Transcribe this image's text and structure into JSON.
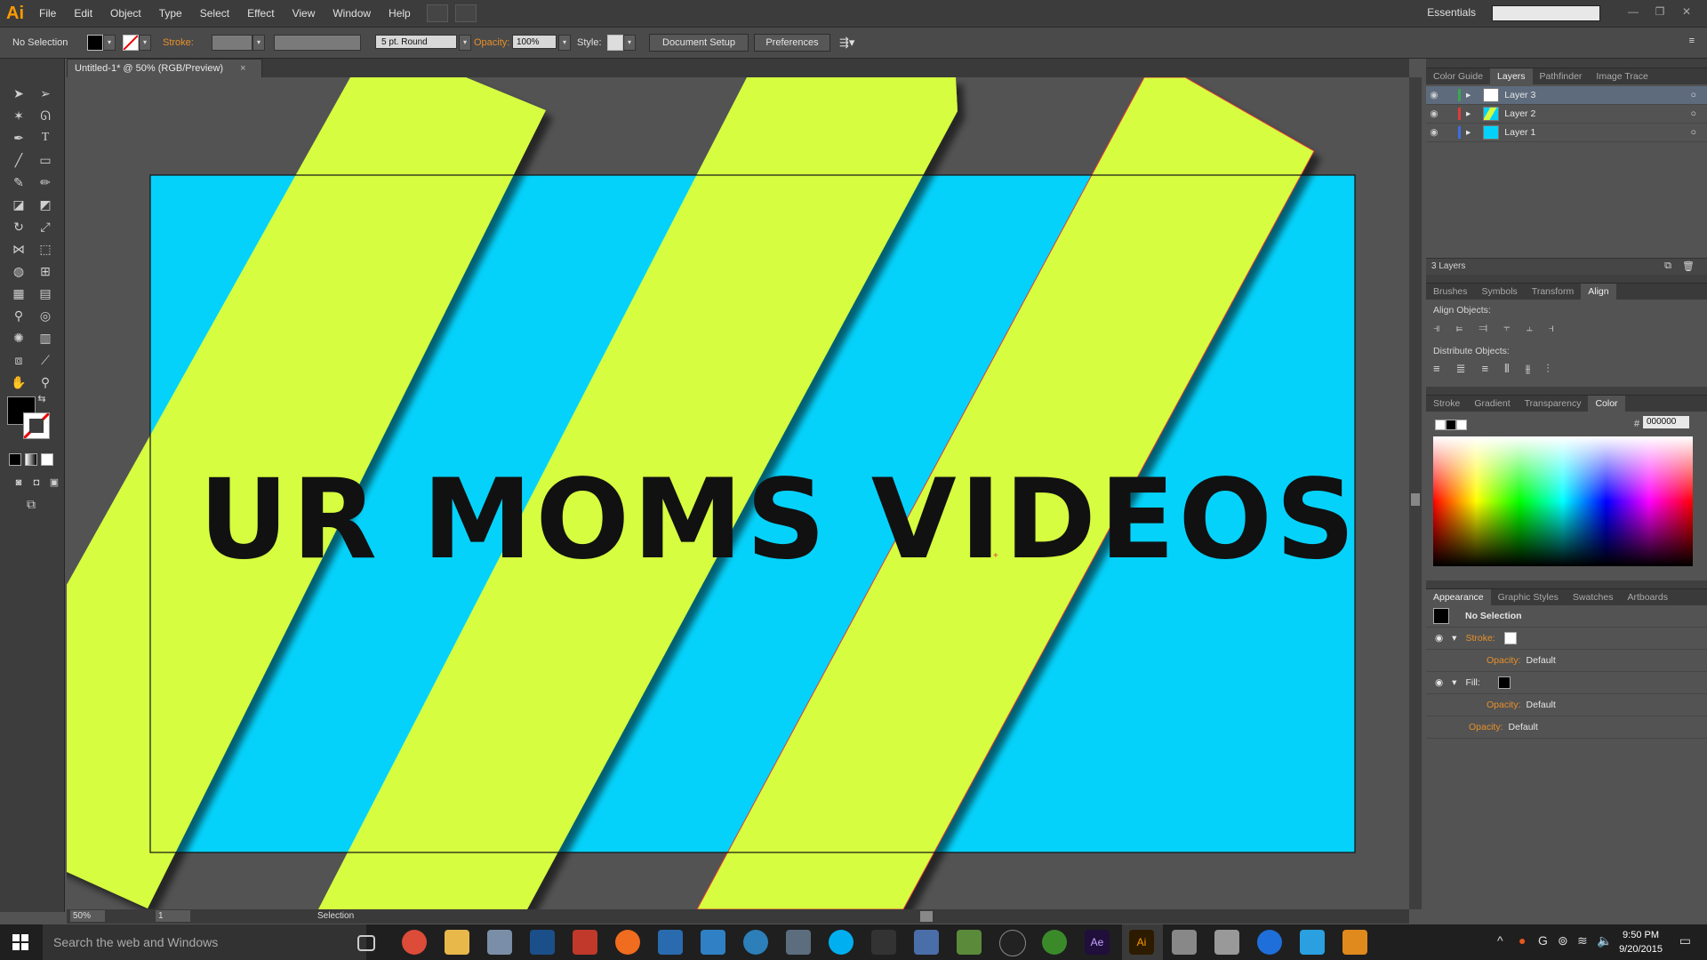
{
  "app": {
    "logo": "Ai"
  },
  "menu": [
    "File",
    "Edit",
    "Object",
    "Type",
    "Select",
    "Effect",
    "View",
    "Window",
    "Help"
  ],
  "workspace": "Essentials",
  "controlbar": {
    "selection_state": "No Selection",
    "stroke_label": "Stroke:",
    "brush": "5 pt. Round",
    "opacity_label": "Opacity:",
    "opacity_value": "100%",
    "style_label": "Style:",
    "document_setup": "Document Setup",
    "preferences": "Preferences"
  },
  "document": {
    "tab_title": "Untitled-1* @ 50% (RGB/Preview)"
  },
  "artwork": {
    "headline": "UR MOMS VIDEOS",
    "colors": {
      "cyan": "#05d2fb",
      "lime": "#d6fd3f",
      "text": "#111111"
    }
  },
  "layers_panel": {
    "tabs": [
      "Color Guide",
      "Layers",
      "Pathfinder",
      "Image Trace"
    ],
    "active_tab": "Layers",
    "layers": [
      {
        "name": "Layer 3",
        "color": "#3aa84c",
        "selected": true
      },
      {
        "name": "Layer 2",
        "color": "#e23a3a",
        "selected": false
      },
      {
        "name": "Layer 1",
        "color": "#3b6fe0",
        "selected": false
      }
    ],
    "count": "3 Layers"
  },
  "align_panel": {
    "tabs": [
      "Brushes",
      "Symbols",
      "Transform",
      "Align"
    ],
    "align_label": "Align Objects:",
    "distribute_label": "Distribute Objects:"
  },
  "color_panel": {
    "tabs": [
      "Stroke",
      "Gradient",
      "Transparency",
      "Color"
    ],
    "hex_label": "#",
    "hex_value": "000000"
  },
  "appearance_panel": {
    "tabs": [
      "Appearance",
      "Graphic Styles",
      "Swatches",
      "Artboards"
    ],
    "title": "No Selection",
    "stroke_label": "Stroke:",
    "fill_label": "Fill:",
    "opacity_label": "Opacity:",
    "opacity_value": "Default"
  },
  "status": {
    "zoom": "50%",
    "artboard": "1",
    "tool": "Selection"
  },
  "taskbar": {
    "search_placeholder": "Search the web and Windows",
    "time": "9:50 PM",
    "date": "9/20/2015"
  }
}
